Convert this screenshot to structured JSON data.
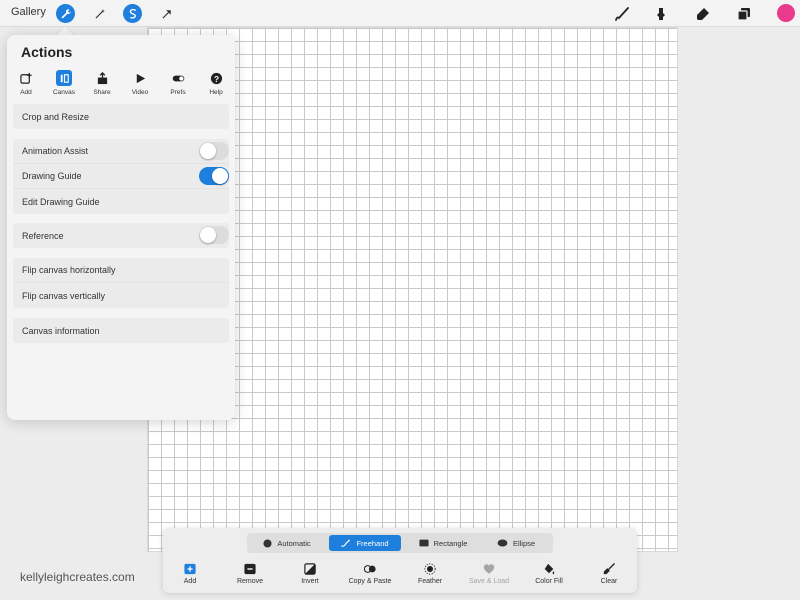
{
  "topbar": {
    "gallery_label": "Gallery",
    "left_tools": [
      {
        "name": "wrench-icon",
        "active": true
      },
      {
        "name": "magic-wand-icon",
        "active": false
      },
      {
        "name": "selection-icon",
        "active": true
      },
      {
        "name": "transform-arrow-icon",
        "active": false
      }
    ],
    "right_tools": [
      "brush-icon",
      "smudge-icon",
      "eraser-icon",
      "layers-icon"
    ],
    "current_color": "#ea3a8c"
  },
  "actions": {
    "title": "Actions",
    "tabs": [
      {
        "label": "Add",
        "icon": "add-icon"
      },
      {
        "label": "Canvas",
        "icon": "canvas-icon",
        "active": true
      },
      {
        "label": "Share",
        "icon": "share-icon"
      },
      {
        "label": "Video",
        "icon": "play-icon"
      },
      {
        "label": "Prefs",
        "icon": "toggle-icon"
      },
      {
        "label": "Help",
        "icon": "help-icon"
      }
    ],
    "rows": {
      "crop": "Crop and Resize",
      "animation_assist": "Animation Assist",
      "drawing_guide": "Drawing Guide",
      "edit_drawing_guide": "Edit Drawing Guide",
      "reference": "Reference",
      "flip_h": "Flip canvas horizontally",
      "flip_v": "Flip canvas vertically",
      "canvas_info": "Canvas information"
    },
    "toggles": {
      "animation_assist": false,
      "drawing_guide": true,
      "reference": false
    }
  },
  "selection": {
    "modes": [
      {
        "label": "Automatic",
        "icon": "automatic-icon"
      },
      {
        "label": "Freehand",
        "icon": "freehand-icon",
        "active": true
      },
      {
        "label": "Rectangle",
        "icon": "rectangle-icon"
      },
      {
        "label": "Ellipse",
        "icon": "ellipse-icon"
      }
    ],
    "tools": [
      {
        "label": "Add",
        "icon": "add-icon"
      },
      {
        "label": "Remove",
        "icon": "remove-icon"
      },
      {
        "label": "Invert",
        "icon": "invert-icon"
      },
      {
        "label": "Copy & Paste",
        "icon": "copy-paste-icon"
      },
      {
        "label": "Feather",
        "icon": "feather-icon"
      },
      {
        "label": "Save & Load",
        "icon": "heart-icon",
        "disabled": true
      },
      {
        "label": "Color Fill",
        "icon": "color-fill-icon"
      },
      {
        "label": "Clear",
        "icon": "clear-icon"
      }
    ]
  },
  "watermark": "kellyleighcreates.com",
  "colors": {
    "accent": "#1e7fdd",
    "current_color": "#ea3a8c"
  }
}
